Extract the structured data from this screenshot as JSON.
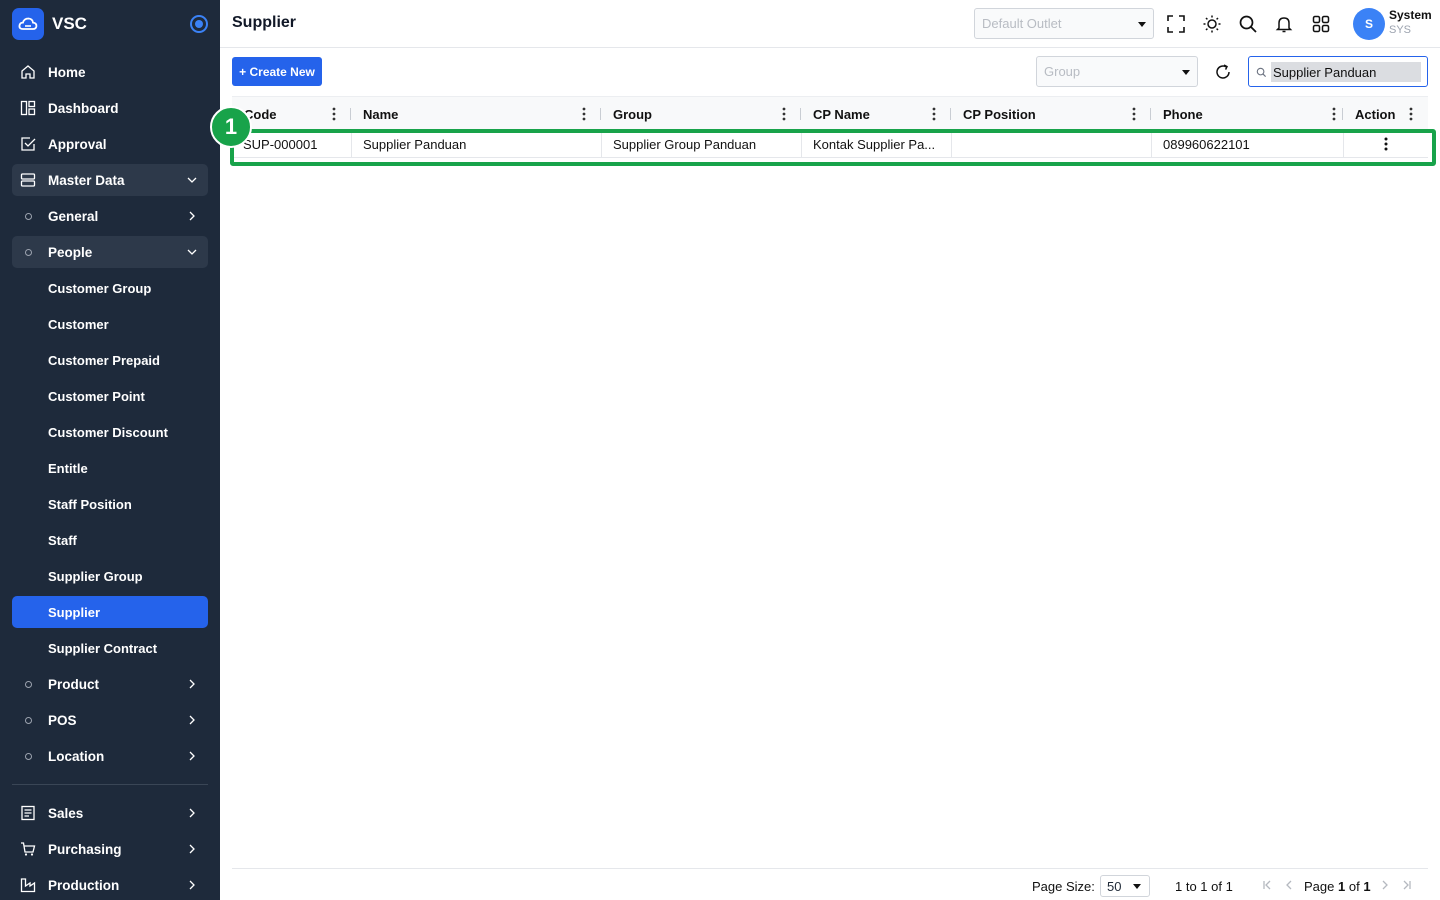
{
  "brand": {
    "name": "VSC"
  },
  "sidebar": {
    "items": [
      {
        "label": "Home",
        "icon": "home-icon"
      },
      {
        "label": "Dashboard",
        "icon": "dashboard-icon"
      },
      {
        "label": "Approval",
        "icon": "approval-icon"
      },
      {
        "label": "Master Data",
        "icon": "database-icon"
      },
      {
        "label": "General"
      },
      {
        "label": "People"
      },
      {
        "label": "Customer Group"
      },
      {
        "label": "Customer"
      },
      {
        "label": "Customer Prepaid"
      },
      {
        "label": "Customer Point"
      },
      {
        "label": "Customer Discount"
      },
      {
        "label": "Entitle"
      },
      {
        "label": "Staff Position"
      },
      {
        "label": "Staff"
      },
      {
        "label": "Supplier Group"
      },
      {
        "label": "Supplier"
      },
      {
        "label": "Supplier Contract"
      },
      {
        "label": "Product"
      },
      {
        "label": "POS"
      },
      {
        "label": "Location"
      },
      {
        "label": "Sales",
        "icon": "sales-icon"
      },
      {
        "label": "Purchasing",
        "icon": "cart-icon"
      },
      {
        "label": "Production",
        "icon": "production-icon"
      }
    ],
    "active_color": "#2563eb",
    "background": "#1e2a3b"
  },
  "header": {
    "title": "Supplier",
    "outlet_placeholder": "Default Outlet",
    "user": {
      "initial": "S",
      "name": "System",
      "code": "SYS"
    }
  },
  "toolbar": {
    "create_label": "+ Create New",
    "group_placeholder": "Group",
    "search_value": "Supplier Panduan"
  },
  "grid": {
    "columns": [
      "Code",
      "Name",
      "Group",
      "CP Name",
      "CP Position",
      "Phone",
      "Action"
    ],
    "rows": [
      {
        "code": "SUP-000001",
        "name": "Supplier Panduan",
        "group": "Supplier Group Panduan",
        "cp_name": "Kontak Supplier Pa...",
        "cp_position": "",
        "phone": "089960622101"
      }
    ]
  },
  "annotation": {
    "step": "1",
    "color": "#18a34a"
  },
  "footer": {
    "page_size_label": "Page Size:",
    "page_size": "50",
    "range": "1 to 1 of 1",
    "page_prefix": "Page",
    "page_current": "1",
    "page_of": "of",
    "page_total": "1"
  }
}
